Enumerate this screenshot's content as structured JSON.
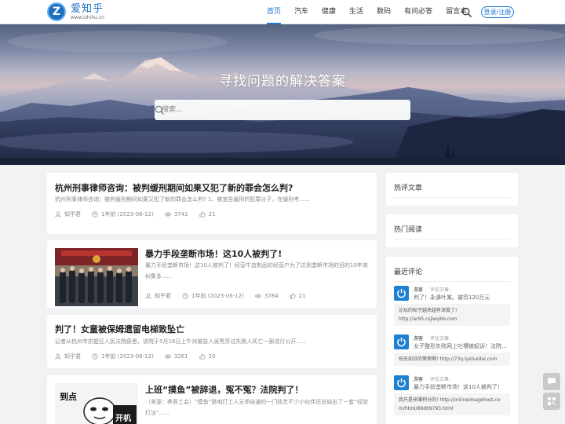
{
  "header": {
    "logo_letter": "Z",
    "logo_name": "爱知乎",
    "logo_url": "www.izhihu.cn",
    "nav": [
      "首页",
      "汽车",
      "健康",
      "生活",
      "数码",
      "有问必答",
      "留言本"
    ],
    "active_nav": "首页",
    "login_label": "登录/注册"
  },
  "hero": {
    "title": "寻找问题的解决答案",
    "search_placeholder": "搜索..."
  },
  "posts": [
    {
      "title": "杭州刑事律师咨询：被判缓刑期间如果又犯了新的罪会怎么判?",
      "excerpt": "杭州刑事律师咨询：被判缓刑期间如果又犯了新的罪会怎么判? 1、被宣告缓刑的犯罪分子，在缓刑考......",
      "author": "知乎君",
      "date": "1年前 (2023-06-12)",
      "views": "3742",
      "likes": "21"
    },
    {
      "title": "暴力手段垄断市场！这10人被判了!",
      "excerpt": "暴力手段垄断市场！这10人被判了！经营牛血制品的经营户为了达到垄断市场的目的10年来纠集多......",
      "author": "知乎君",
      "date": "1年前 (2023-06-12)",
      "views": "3784",
      "likes": "21"
    },
    {
      "title": "判了！女童被保姆遗留电梯致坠亡",
      "excerpt": "记者从杭州市拱墅区人民法院获悉，该院于5月18日上午对被告人吴秀芳过失致人死亡一案进行公开......",
      "author": "知乎君",
      "date": "1年前 (2023-06-12)",
      "views": "3261",
      "likes": "20"
    },
    {
      "title": "上班“摸鱼”被辞退，冤不冤？法院判了！",
      "excerpt": "（来源：养质工会）“摸鱼”是咱打工人无师自通的一门技艺不少小伙伴还总结出了一套“经验打法”......",
      "thumb_top": "到点",
      "thumb_bottom": "开机"
    }
  ],
  "sidebar": {
    "hot_comment_title": "热评文章",
    "hot_read_title": "热门阅读",
    "recent_title": "最近评论",
    "comments": [
      {
        "user": "游客",
        "on": "评论文章:",
        "article": "判了！永濞叶某。被罚120万元",
        "text": "论坛的帖子越来越有深度了! http://ar95.csjlwybb.com"
      },
      {
        "user": "游客",
        "on": "评论文章:",
        "article": "女子整形失败网上吐槽被起诉！法院...",
        "text": "祝充如日的策荣啊! http://73q.lyshuidai.com"
      },
      {
        "user": "游客",
        "on": "评论文章:",
        "article": "暴力手段垄断市场！这10人被判了!",
        "text": "我只是来赚积分的! http://onlineimagehost.com/html/89d09793.html"
      }
    ]
  },
  "float_buttons": [
    "chat-icon",
    "qrcode-icon"
  ],
  "colors": {
    "accent": "#1a78d6",
    "background": "#f1f2f4"
  }
}
